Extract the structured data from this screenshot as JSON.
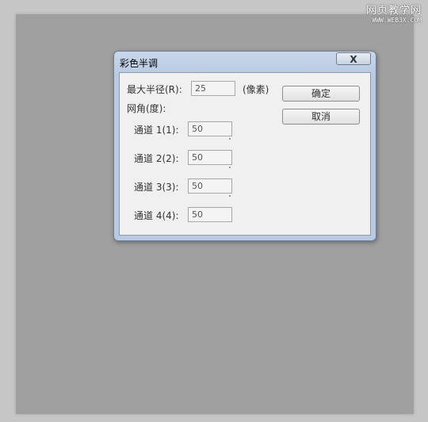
{
  "watermark": {
    "title": "网页教学网",
    "url": "WWW.WEB3X.COM"
  },
  "dialog": {
    "title": "彩色半调",
    "close_label": "X",
    "max_radius": {
      "label": "最大半径(R):",
      "value": "25",
      "unit": "(像素)"
    },
    "screen_angles_label": "网角(度):",
    "channels": [
      {
        "label": "通道 1(1):",
        "value": "50"
      },
      {
        "label": "通道 2(2):",
        "value": "50"
      },
      {
        "label": "通道 3(3):",
        "value": "50"
      },
      {
        "label": "通道 4(4):",
        "value": "50"
      }
    ],
    "ok_label": "确定",
    "cancel_label": "取消"
  },
  "colors": {
    "canvas": "#a0a0a0",
    "background": "#c6c6c6",
    "titlebar": "#b9cbe3",
    "client": "#f0f0f0"
  }
}
